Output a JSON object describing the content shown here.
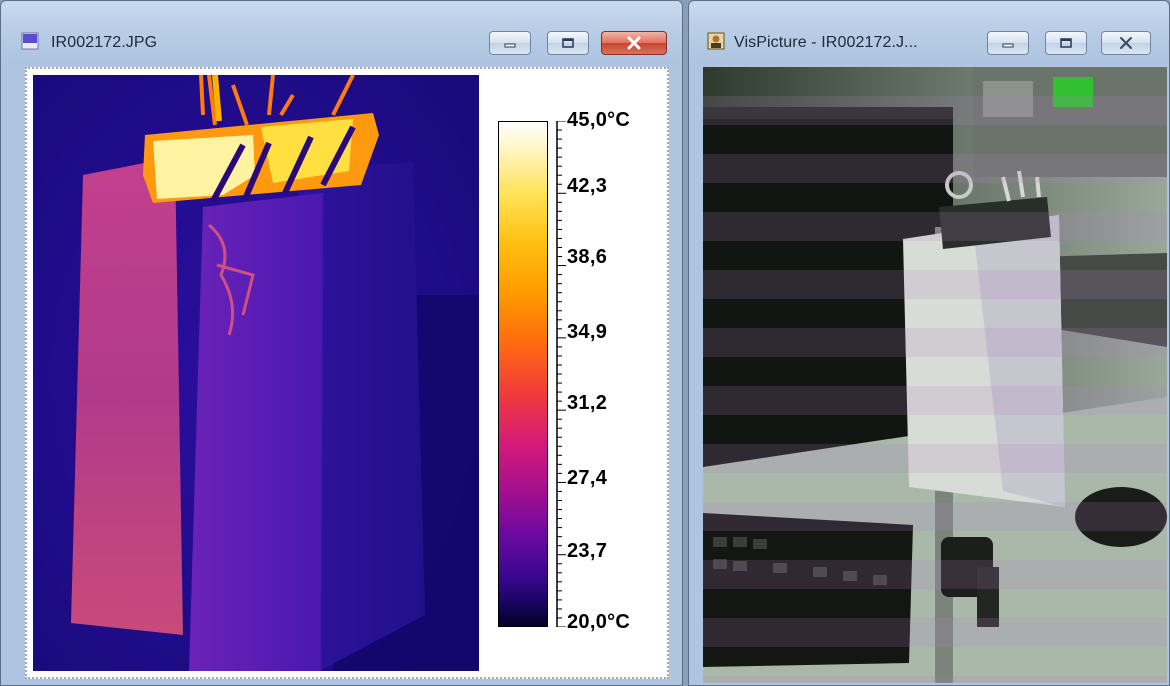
{
  "ir_window": {
    "title": "IR002172.JPG",
    "icon": "ir-image-icon",
    "controls": {
      "minimize": "minimize-icon",
      "maximize": "maximize-icon",
      "close": "close-icon"
    },
    "scale": {
      "unit": "°C",
      "labels": [
        "45,0°C",
        "42,3",
        "38,6",
        "34,9",
        "31,2",
        "27,4",
        "23,7",
        "20,0°C"
      ],
      "max": 45.0,
      "min": 20.0
    }
  },
  "vis_window": {
    "title": "VisPicture - IR002172.J...",
    "icon": "camera-picture-icon",
    "controls": {
      "minimize": "minimize-icon",
      "maximize": "maximize-icon",
      "close": "close-icon"
    }
  },
  "colors": {
    "titlebar": "#b9cde6",
    "close_active": "#c74430",
    "palette_hot": "#ffffff",
    "palette_cold": "#050022"
  }
}
